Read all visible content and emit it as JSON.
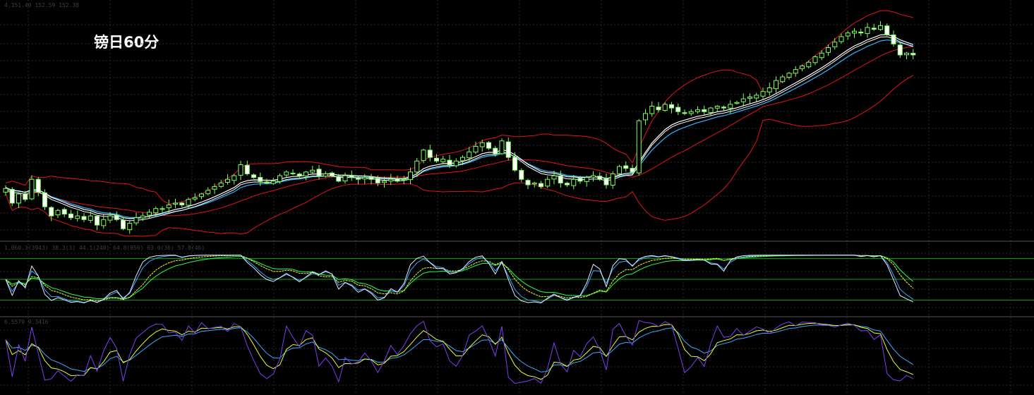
{
  "chart_data": {
    "type": "candlestick",
    "title": "镑日60分",
    "colors": {
      "background": "#000000",
      "grid": "#2a2a2a",
      "candle": "#7cff5a",
      "candle_up_body": "#000000",
      "candle_down_body": "#ffffff",
      "bollinger": "#e0141a",
      "ma_fast": "#ffffff",
      "ma_slow": "#2fb4ff",
      "level_line": "#19a019",
      "osc_white": "#e9e9ff",
      "osc_blue": "#3ca8ff",
      "osc_yellow": "#e8ff28",
      "osc_green": "#28ff55",
      "osc_purple": "#7b3ff0"
    },
    "main_readout": "4,151.40 152.59 152.38",
    "panel2_readout": "1,060.3(3943) 38.3(3) 44.1(248) 64.8(856) 63.0(36) 57.8(46)",
    "panel3_readout": "6.5579 9.3416",
    "close": [
      155,
      147,
      152,
      149,
      160,
      153,
      145,
      140,
      143,
      141,
      139,
      140,
      138,
      140,
      135,
      138,
      140,
      138,
      133,
      136,
      139,
      140,
      142,
      144,
      144,
      146,
      147,
      146,
      149,
      150,
      152,
      154,
      156,
      158,
      160,
      162,
      168,
      163,
      161,
      159,
      158,
      159,
      162,
      164,
      163,
      162,
      164,
      165,
      162,
      163,
      162,
      159,
      162,
      161,
      160,
      161,
      160,
      158,
      159,
      160,
      159,
      160,
      164,
      170,
      176,
      172,
      170,
      171,
      168,
      170,
      172,
      175,
      178,
      180,
      177,
      174,
      181,
      172,
      165,
      160,
      157,
      158,
      156,
      160,
      162,
      158,
      157,
      160,
      159,
      161,
      162,
      160,
      157,
      163,
      167,
      166,
      164,
      192,
      196,
      200,
      198,
      201,
      199,
      197,
      196,
      197,
      198,
      197,
      199,
      200,
      199,
      201,
      202,
      204,
      205,
      206,
      208,
      210,
      214,
      216,
      218,
      220,
      222,
      224,
      227,
      229,
      232,
      235,
      238,
      240,
      241,
      240,
      243,
      242,
      244,
      239,
      234,
      228,
      229,
      228
    ],
    "osc_levels": [
      80,
      50,
      20
    ]
  }
}
